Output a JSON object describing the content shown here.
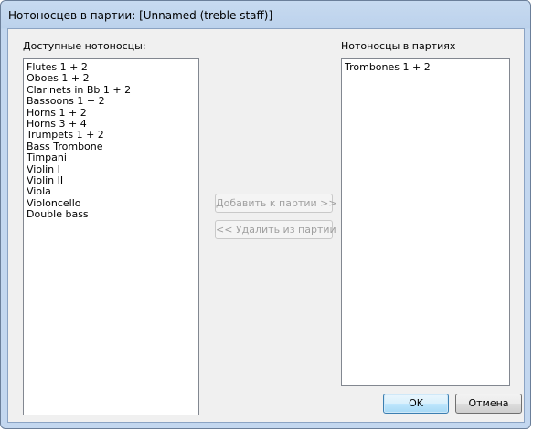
{
  "window": {
    "title": "Нотоносцев в партии: [Unnamed (treble staff)]"
  },
  "left_list": {
    "label": "Доступные нотоносцы:",
    "items": [
      "Flutes 1 + 2",
      "Oboes 1 + 2",
      "Clarinets in Bb 1 + 2",
      "Bassoons 1 + 2",
      "Horns 1 + 2",
      "Horns 3 + 4",
      "Trumpets 1 + 2",
      "Bass Trombone",
      "Timpani",
      "Violin I",
      "Violin II",
      "Viola",
      "Violoncello",
      "Double bass"
    ]
  },
  "right_list": {
    "label": "Нотоносцы в партиях",
    "items": [
      "Trombones 1 + 2"
    ]
  },
  "buttons": {
    "add": "Добавить к партии >>",
    "remove": "<< Удалить из партии",
    "ok": "OK",
    "cancel": "Отмена"
  }
}
